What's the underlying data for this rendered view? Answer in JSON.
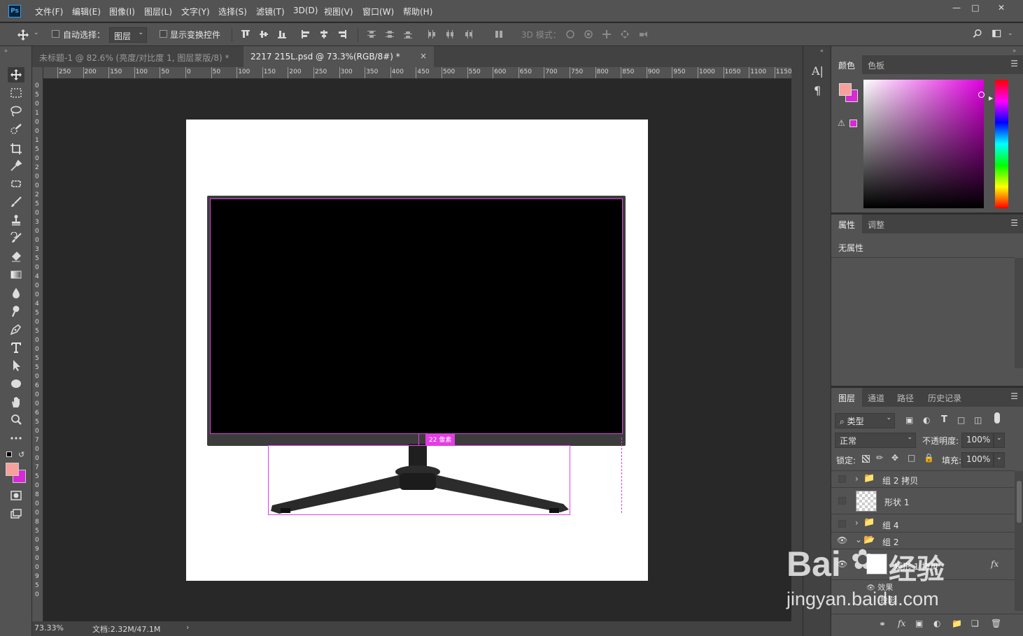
{
  "menubar": {
    "logo": "Ps",
    "items": [
      "文件(F)",
      "编辑(E)",
      "图像(I)",
      "图层(L)",
      "文字(Y)",
      "选择(S)",
      "滤镜(T)",
      "3D(D)",
      "视图(V)",
      "窗口(W)",
      "帮助(H)"
    ]
  },
  "options": {
    "auto_select_label": "自动选择：",
    "auto_select_target": "图层",
    "show_transform_label": "显示变换控件",
    "mode_3d_label": "3D 模式："
  },
  "tabs": [
    {
      "label": "未标题-1 @ 82.6% (亮度/对比度 1, 图层蒙版/8) *",
      "active": false
    },
    {
      "label": "2217 215L.psd @ 73.3%(RGB/8#) *",
      "active": true
    }
  ],
  "ruler": {
    "h_ticks": [
      "250",
      "200",
      "150",
      "100",
      "50",
      "0",
      "50",
      "100",
      "150",
      "200",
      "250",
      "300",
      "350",
      "400",
      "450",
      "500",
      "550",
      "600",
      "650",
      "700",
      "750",
      "800",
      "850",
      "900",
      "950",
      "1000",
      "1050",
      "1100",
      "1150"
    ],
    "v_ticks": [
      "0",
      "5",
      "0",
      "1",
      "0",
      "0",
      "1",
      "5",
      "0",
      "2",
      "0",
      "0",
      "2",
      "5",
      "0",
      "3",
      "0",
      "0",
      "3",
      "5",
      "0",
      "4",
      "0",
      "0",
      "4",
      "5",
      "0",
      "5",
      "0",
      "0",
      "5",
      "5",
      "0",
      "6",
      "0",
      "0",
      "6",
      "5",
      "0",
      "7",
      "0",
      "0",
      "7",
      "5",
      "0",
      "8",
      "0",
      "0",
      "8",
      "5",
      "0",
      "9",
      "0",
      "0",
      "9",
      "5",
      "0"
    ]
  },
  "canvas": {
    "measure_label": "22 像素"
  },
  "status": {
    "zoom": "73.33%",
    "doc": "文档:2.32M/47.1M"
  },
  "color_panel": {
    "tabs": [
      "颜色",
      "色板"
    ],
    "fg_color": "#f7a09c",
    "bg_color": "#d62ad6"
  },
  "properties_panel": {
    "tabs": [
      "属性",
      "调整"
    ],
    "empty_text": "无属性"
  },
  "layers_panel": {
    "tabs": [
      "图层",
      "通道",
      "路径",
      "历史记录"
    ],
    "filter_kind": "类型",
    "blend_mode": "正常",
    "opacity_label": "不透明度:",
    "opacity_value": "100%",
    "lock_label": "锁定:",
    "fill_label": "填充:",
    "fill_value": "100%",
    "layers": [
      {
        "name": "组 2 拷贝",
        "kind": "group",
        "visible": false
      },
      {
        "name": "形状 1",
        "kind": "shape",
        "visible": false
      },
      {
        "name": "组 4",
        "kind": "group",
        "visible": false
      },
      {
        "name": "组 2",
        "kind": "group",
        "visible": true
      },
      {
        "name": "矩形 1 拷贝",
        "kind": "shape",
        "visible": true,
        "fx": "fx"
      }
    ],
    "effects_label": "效果",
    "effect_item": "投影"
  },
  "watermark": {
    "brand": "Bai",
    "brand_cn": "经验",
    "url": "jingyan.baidu.com"
  }
}
